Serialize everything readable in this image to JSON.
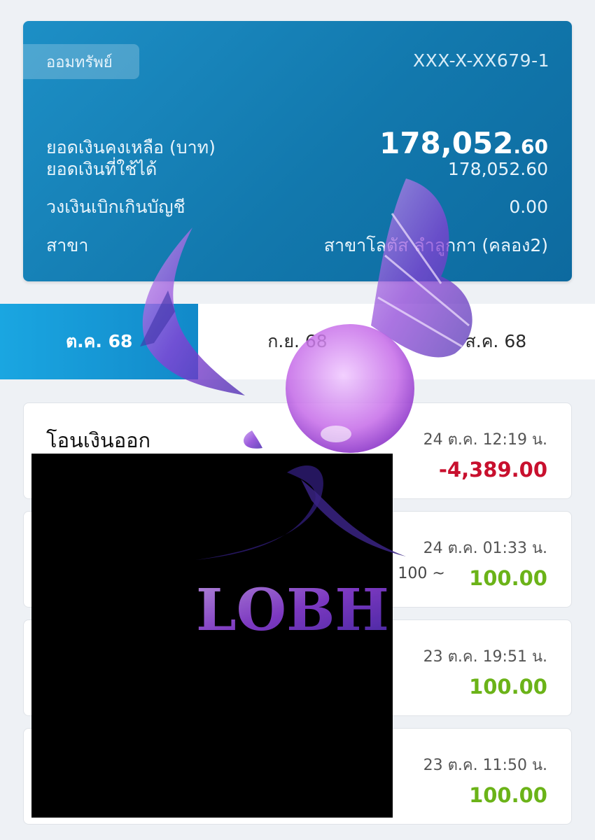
{
  "account": {
    "type_label": "ออมทรัพย์",
    "number": "XXX-X-XX679-1",
    "balance_label": "ยอดเงินคงเหลือ (บาท)",
    "balance_main": "178,052",
    "balance_decimal": ".60",
    "available_label": "ยอดเงินที่ใช้ได้",
    "available_value": "178,052.60",
    "overdraft_label": "วงเงินเบิกเกินบัญชี",
    "overdraft_value": "0.00",
    "branch_label": "สาขา",
    "branch_value": "สาขาโลตัส ลำลูกกา (คลอง2)"
  },
  "tabs": [
    {
      "label": "ต.ค. 68",
      "active": true
    },
    {
      "label": "ก.ย. 68",
      "active": false
    },
    {
      "label": "ส.ค. 68",
      "active": false
    }
  ],
  "transactions": [
    {
      "title": "โอนเงินออก",
      "date": "24 ต.ค. 12:19 น.",
      "amount": "-4,389.00",
      "note": ""
    },
    {
      "title": "",
      "date": "24 ต.ค. 01:33 น.",
      "amount": "100.00",
      "note": ": 100 ~"
    },
    {
      "title": "",
      "date": "23 ต.ค. 19:51 น.",
      "amount": "100.00",
      "note": ""
    },
    {
      "title": "",
      "date": "23 ต.ค. 11:50 น.",
      "amount": "100.00",
      "note": ""
    }
  ],
  "watermark": {
    "text": "LOBH"
  },
  "colors": {
    "card": "#1278ad",
    "tab_active": "#1aa6e1",
    "amount_negative": "#c8102e",
    "amount_positive": "#6bb318",
    "watermark": "#8a3fd6"
  }
}
